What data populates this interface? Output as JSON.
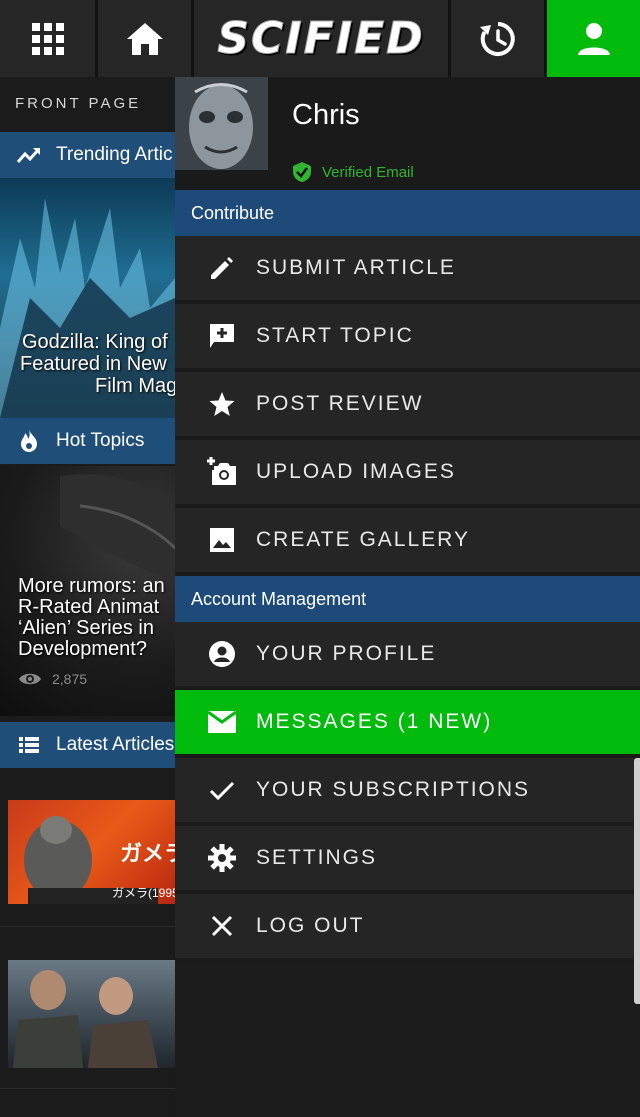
{
  "topbar": {
    "logo": "SCIFIED",
    "icons": [
      "apps-grid-icon",
      "home-icon",
      "history-icon",
      "account-icon"
    ],
    "account_active_color": "#00bb0b"
  },
  "background": {
    "front_page_label": "FRONT PAGE",
    "sections": {
      "trending": "Trending Artic",
      "hot_topics": "Hot Topics",
      "latest": "Latest Articles"
    },
    "trending_title": [
      "Godzilla: King of",
      "Featured in New",
      "Film Mag"
    ],
    "hot_title": [
      "More rumors: an",
      "R-Rated Animat",
      "‘Alien’ Series in",
      "Development?"
    ],
    "hot_views": "2,875",
    "thumb1_caption": "ガメラ",
    "thumb1_year": "ガメラ(1995",
    "section_color": "#1f4e79"
  },
  "drawer": {
    "user": {
      "name": "Chris",
      "verified_label": "Verified Email"
    },
    "groups": {
      "contribute": "Contribute",
      "account": "Account Management"
    },
    "contribute_items": [
      {
        "label": "SUBMIT ARTICLE",
        "icon": "pencil-icon"
      },
      {
        "label": "START TOPIC",
        "icon": "add-comment-icon"
      },
      {
        "label": "POST REVIEW",
        "icon": "star-icon"
      },
      {
        "label": "UPLOAD IMAGES",
        "icon": "add-camera-icon"
      },
      {
        "label": "CREATE GALLERY",
        "icon": "image-icon"
      }
    ],
    "account_items": [
      {
        "label": "YOUR PROFILE",
        "icon": "account-circle-icon"
      },
      {
        "label": "MESSAGES (1 NEW)",
        "icon": "mail-icon",
        "active": true
      },
      {
        "label": "YOUR SUBSCRIPTIONS",
        "icon": "check-icon"
      },
      {
        "label": "SETTINGS",
        "icon": "gear-icon"
      },
      {
        "label": "LOG OUT",
        "icon": "close-icon"
      }
    ],
    "active_color": "#00bb0b",
    "group_color": "#1d4a78"
  }
}
